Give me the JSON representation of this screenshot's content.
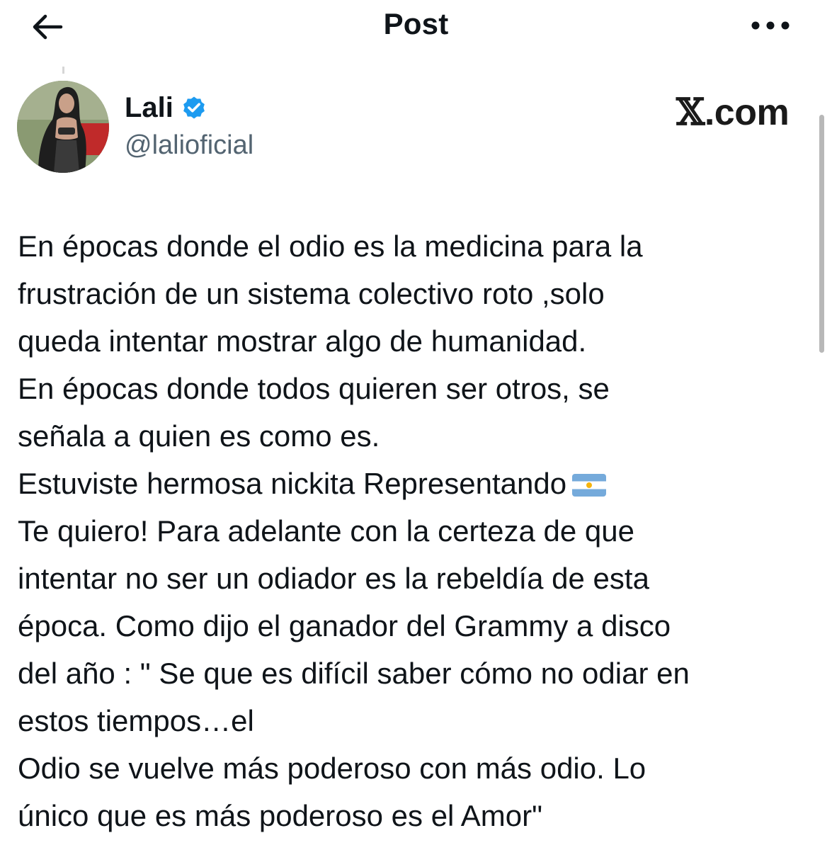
{
  "header": {
    "title": "Post",
    "back_icon": "arrow-left-icon",
    "more_icon": "more-horizontal-icon"
  },
  "author": {
    "display_name": "Lali",
    "handle": "@lalioficial",
    "verified": true,
    "verified_color": "#1d9bf0"
  },
  "watermark": {
    "x_glyph": "𝕏",
    "suffix": ".com"
  },
  "tweet": {
    "lines": [
      "En épocas donde el odio es la medicina para la",
      "frustración de un sistema colectivo roto ,solo",
      "queda intentar mostrar algo de humanidad.",
      "En épocas donde todos quieren ser otros, se",
      "señala a quien es como es.",
      "Estuviste hermosa nickita Representando",
      "Te quiero! Para adelante con la certeza de que",
      "intentar no ser un odiador es la rebeldía de esta",
      "época. Como dijo el ganador del Grammy a disco",
      "del año : \" Se que es difícil saber cómo no odiar en",
      "estos tiempos…el",
      "Odio se vuelve más poderoso con más odio. Lo",
      "único que es más poderoso es el Amor\""
    ],
    "flag_emoji": "argentina-flag-icon"
  }
}
